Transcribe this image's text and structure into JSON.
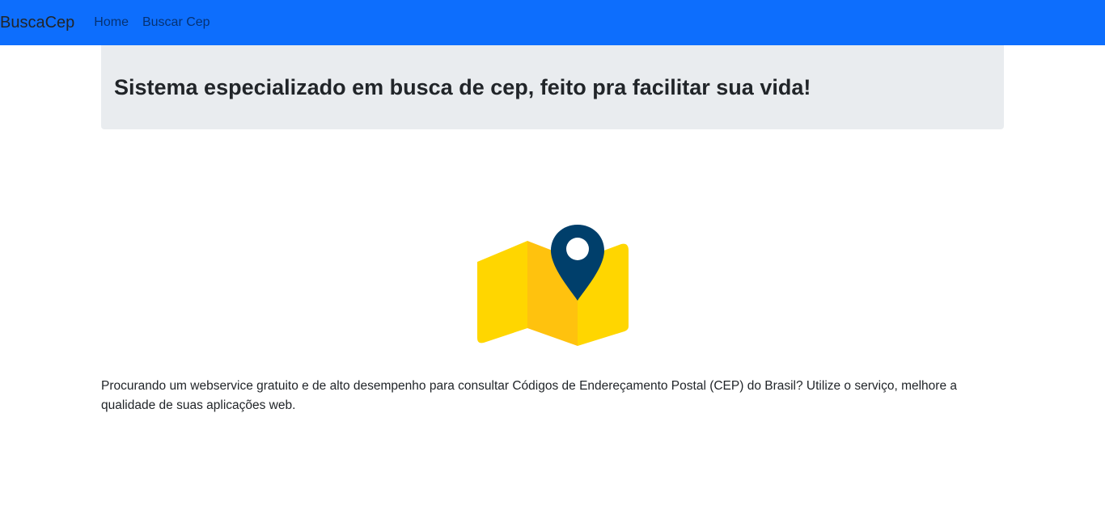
{
  "navbar": {
    "brand": "BuscaCep",
    "links": [
      {
        "label": "Home"
      },
      {
        "label": "Buscar Cep"
      }
    ],
    "background_color": "#0d6efd"
  },
  "hero": {
    "title": "Sistema especializado em busca de cep, feito pra facilitar sua vida!",
    "background_color": "#e9ecef"
  },
  "illustration": {
    "icon": "map-with-location-pin-icon",
    "colors": {
      "map_light": "#FFD600",
      "map_dark": "#FFC20E",
      "pin": "#003F6B"
    }
  },
  "description": "Procurando um webservice gratuito e de alto desempenho para consultar Códigos de Endereçamento Postal (CEP) do Brasil? Utilize o serviço, melhore a qualidade de suas aplicações web."
}
